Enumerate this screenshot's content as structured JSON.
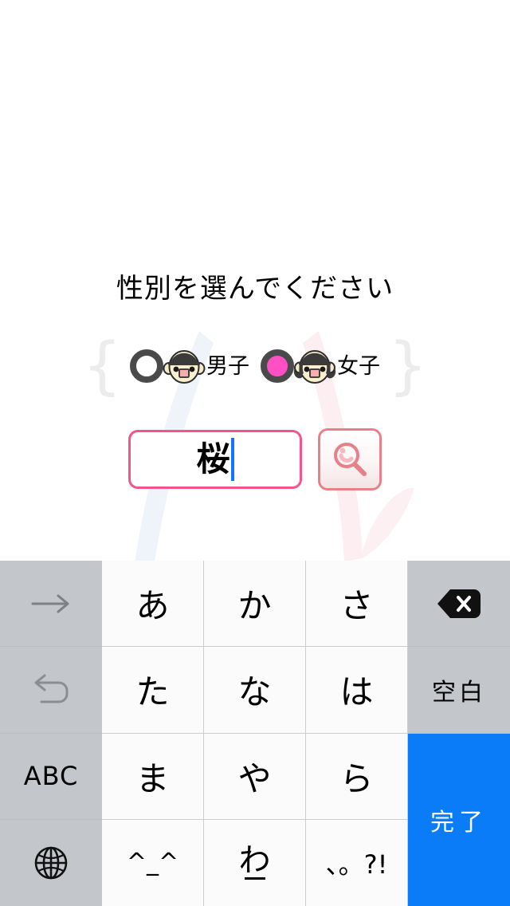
{
  "screen": {
    "background_color": "#ffffff",
    "accent_pink": "#f4538e",
    "radio_checked_color": "#ff4fc4",
    "done_key_color": "#0a7cf7"
  },
  "form": {
    "title": "性別を選んでください",
    "brace_left": "{",
    "brace_right": "}",
    "options": [
      {
        "label": "男子",
        "icon": "boy-face-icon",
        "selected": false
      },
      {
        "label": "女子",
        "icon": "girl-face-icon",
        "selected": true
      }
    ],
    "name_input": {
      "value": "桜",
      "placeholder": "",
      "border_color": "#f4538e",
      "caret_color": "#1673ff"
    },
    "search_button": {
      "icon": "magnifier-icon",
      "label": "",
      "border_color": "#e8808a"
    }
  },
  "keyboard": {
    "rows": [
      [
        {
          "name": "next-candidate-key",
          "label": "",
          "icon": "arrow-right-icon",
          "type": "side"
        },
        {
          "name": "kana-a-key",
          "label": "あ",
          "type": "kana"
        },
        {
          "name": "kana-ka-key",
          "label": "か",
          "type": "kana"
        },
        {
          "name": "kana-sa-key",
          "label": "さ",
          "type": "kana"
        },
        {
          "name": "delete-key",
          "label": "",
          "icon": "backspace-icon",
          "type": "side"
        }
      ],
      [
        {
          "name": "undo-key",
          "label": "",
          "icon": "undo-icon",
          "type": "side"
        },
        {
          "name": "kana-ta-key",
          "label": "た",
          "type": "kana"
        },
        {
          "name": "kana-na-key",
          "label": "な",
          "type": "kana"
        },
        {
          "name": "kana-ha-key",
          "label": "は",
          "type": "kana"
        },
        {
          "name": "space-key",
          "label": "空白",
          "type": "side"
        }
      ],
      [
        {
          "name": "abc-key",
          "label": "ABC",
          "type": "side"
        },
        {
          "name": "kana-ma-key",
          "label": "ま",
          "type": "kana"
        },
        {
          "name": "kana-ya-key",
          "label": "や",
          "type": "kana"
        },
        {
          "name": "kana-ra-key",
          "label": "ら",
          "type": "kana"
        },
        {
          "name": "done-key",
          "label": "完了",
          "type": "done"
        }
      ],
      [
        {
          "name": "globe-key",
          "label": "",
          "icon": "globe-icon",
          "type": "side"
        },
        {
          "name": "emoticon-key",
          "label": "^_^",
          "type": "kana"
        },
        {
          "name": "kana-wa-key",
          "label": "わ",
          "sub": "_",
          "type": "kana"
        },
        {
          "name": "punctuation-key",
          "label": "、。?!",
          "type": "kana"
        }
      ]
    ]
  }
}
